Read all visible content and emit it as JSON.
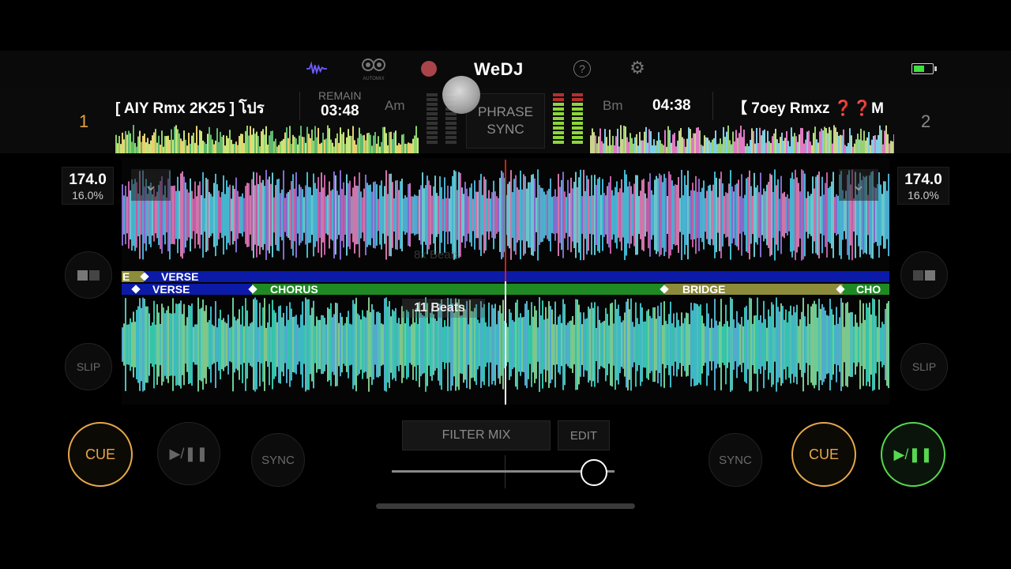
{
  "app": {
    "brand": "WeDJ",
    "automix_label": "AUTOMIX"
  },
  "colors": {
    "accent_orange": "#e7a84c",
    "play_green": "#56d94f",
    "battery_green": "#3ee040",
    "record_red": "#a8444a"
  },
  "top_icons": [
    "waveform-icon",
    "automix-icon",
    "record-icon",
    "help-icon",
    "gear-icon",
    "battery-icon"
  ],
  "deck_left": {
    "number": "1",
    "title": "[ AIY Rmx 2K25 ] โปร",
    "remain_label": "REMAIN",
    "time": "03:48",
    "key": "Am",
    "bpm": "174.0",
    "pitch": "16.0%"
  },
  "deck_right": {
    "number": "2",
    "title": "【 7oey Rmxz ❓❓M",
    "key": "Bm",
    "time": "04:38",
    "bpm": "174.0",
    "pitch": "16.0%"
  },
  "center": {
    "phrase_sync_line1": "PHRASE",
    "phrase_sync_line2": "SYNC"
  },
  "waveform": {
    "top_faded_label": "8x Beats",
    "beats_label": "11 Beats",
    "top_phrases": [
      "E",
      "VERSE"
    ],
    "bottom_phrases": [
      "VERSE",
      "CHORUS",
      "BRIDGE",
      "CHO"
    ]
  },
  "controls": {
    "slip": "SLIP",
    "cue": "CUE",
    "sync": "SYNC",
    "filter_mix": "FILTER MIX",
    "edit": "EDIT",
    "crossfader_level": 0.9
  }
}
